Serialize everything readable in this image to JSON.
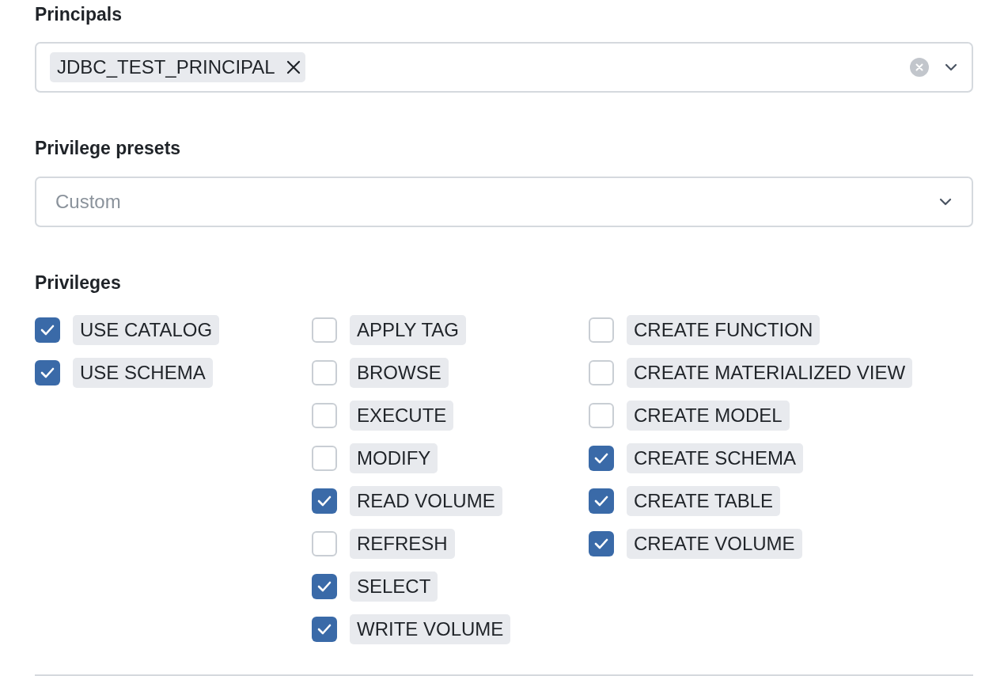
{
  "principals": {
    "label": "Principals",
    "tags": [
      {
        "text": "JDBC_TEST_PRINCIPAL"
      }
    ]
  },
  "presets": {
    "label": "Privilege presets",
    "placeholder": "Custom"
  },
  "privileges": {
    "label": "Privileges",
    "columns": [
      [
        {
          "label": "USE CATALOG",
          "checked": true
        },
        {
          "label": "USE SCHEMA",
          "checked": true
        }
      ],
      [
        {
          "label": "APPLY TAG",
          "checked": false
        },
        {
          "label": "BROWSE",
          "checked": false
        },
        {
          "label": "EXECUTE",
          "checked": false
        },
        {
          "label": "MODIFY",
          "checked": false
        },
        {
          "label": "READ VOLUME",
          "checked": true
        },
        {
          "label": "REFRESH",
          "checked": false
        },
        {
          "label": "SELECT",
          "checked": true
        },
        {
          "label": "WRITE VOLUME",
          "checked": true
        }
      ],
      [
        {
          "label": "CREATE FUNCTION",
          "checked": false
        },
        {
          "label": "CREATE MATERIALIZED VIEW",
          "checked": false
        },
        {
          "label": "CREATE MODEL",
          "checked": false
        },
        {
          "label": "CREATE SCHEMA",
          "checked": true
        },
        {
          "label": "CREATE TABLE",
          "checked": true
        },
        {
          "label": "CREATE VOLUME",
          "checked": true
        }
      ]
    ]
  }
}
